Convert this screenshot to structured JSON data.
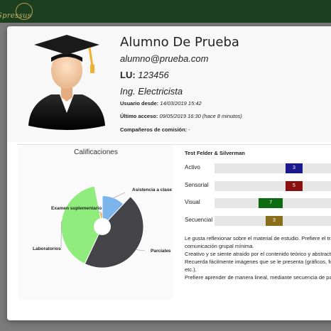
{
  "app": {
    "brand": "Spressus"
  },
  "profile": {
    "name": "Alumno De Prueba",
    "email": "alumno@prueba.com",
    "lu_label": "LU:",
    "lu_value": "123456",
    "career": "Ing. Electricista",
    "since_label": "Usuario desde:",
    "since_value": "14/03/2019 15:42",
    "last_access_label": "Último acceso:",
    "last_access_value": "09/05/2019 16:30 (hace 8 minutos)",
    "peers_label": "Compañeros de comisión:",
    "peers_value": "-"
  },
  "chart_data": {
    "type": "pie",
    "title": "Calificaciones",
    "categories": [
      "Asistencia a clase",
      "Parciales",
      "Laboratorios",
      "Examen suplementario"
    ],
    "values": [
      12,
      45,
      40,
      3
    ],
    "radius_fractions": [
      0.75,
      1.0,
      1.0,
      0.35
    ],
    "colors": [
      "#7cb5ec",
      "#434348",
      "#90ed7d",
      "#f7a35c"
    ],
    "inner_hole": true,
    "legend": "none"
  },
  "felder": {
    "title": "Test Felder & Silverman",
    "dimensions": [
      {
        "label": "Activo",
        "value": "3",
        "score": 3,
        "color": "#1a1a8c"
      },
      {
        "label": "Sensorial",
        "value": "5",
        "score": 5,
        "color": "#8b1010"
      },
      {
        "label": "Visual",
        "value": "7",
        "score": -7,
        "color": "#0d6b12"
      },
      {
        "label": "Secuencial",
        "value": "3",
        "score": -3,
        "color": "#8a6d1a"
      }
    ]
  },
  "description": [
    "Le gusta reflexionar sobre el material de estudio. Prefiere el tra",
    "comunicación grupal mínima.",
    "Creativo y se siente atraído por el contenido teórico y abstract",
    "Recuerda fácilmente imágenes que se le presenta (gráficos, fo",
    "etc.).",
    "Prefiere aprender de manera lineal, mediante secuencia de pa"
  ]
}
